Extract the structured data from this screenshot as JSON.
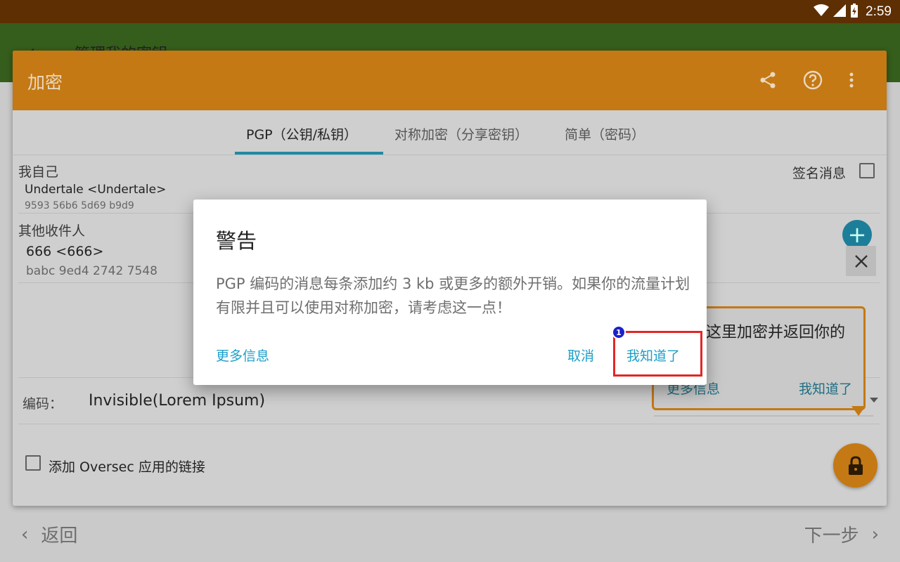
{
  "status_bar": {
    "time": "2:59"
  },
  "background": {
    "title": "管理我的密钥",
    "back_label": "返回",
    "next_label": "下一步"
  },
  "card": {
    "title": "加密",
    "tabs": [
      {
        "label": "PGP（公钥/私钥）",
        "active": true
      },
      {
        "label": "对称加密（分享密钥）",
        "active": false
      },
      {
        "label": "简单（密码）",
        "active": false
      }
    ],
    "self_section": {
      "label": "我自己",
      "key_name": "Undertale <Undertale>",
      "fingerprint": "9593 56b6 5d69 b9d9"
    },
    "sign_label": "签名消息",
    "recipients_section": {
      "label": "其他收件人",
      "key_name": "666 <666>",
      "fingerprint": "babc 9ed4 2742 7548"
    },
    "encoding_label": "编码：",
    "encoding_value": "Invisible(Lorem Ipsum)",
    "add_link_label": "添加 Oversec 应用的链接"
  },
  "tooltip": {
    "text": "这里加密并返回你的",
    "more_label": "更多信息",
    "ok_label": "我知道了"
  },
  "dialog": {
    "title": "警告",
    "message": "PGP 编码的消息每条添加约 3 kb 或更多的额外开销。如果你的流量计划有限并且可以使用对称加密，请考虑这一点！",
    "more_info": "更多信息",
    "cancel": "取消",
    "ok": "我知道了"
  },
  "annotation": {
    "badge": "1"
  },
  "colors": {
    "status_bar": "#5e2f02",
    "toolbar": "#c47914",
    "accent": "#1b9fc9",
    "highlight": "#e32626"
  }
}
